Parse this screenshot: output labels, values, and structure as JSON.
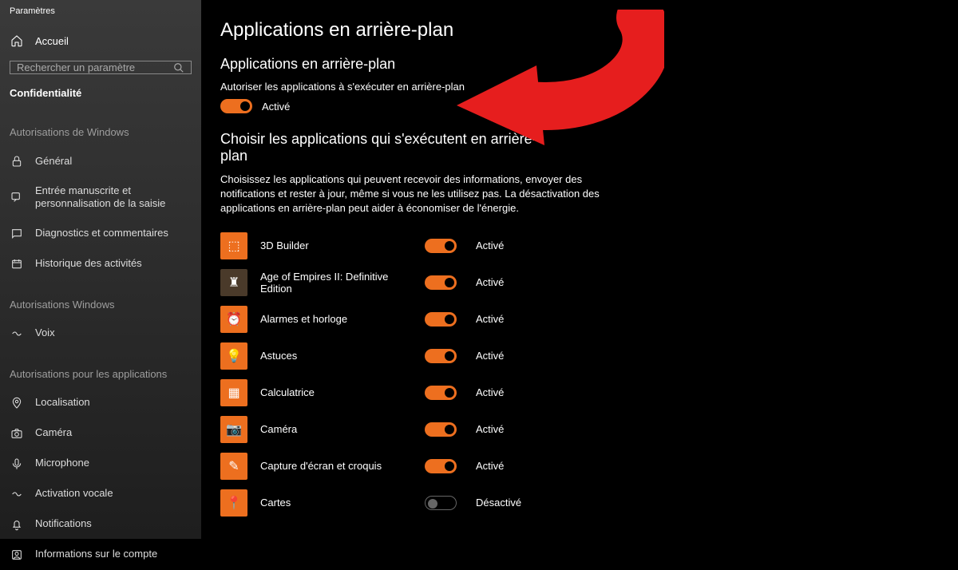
{
  "window_title": "Paramètres",
  "sidebar": {
    "home": "Accueil",
    "search_placeholder": "Rechercher un paramètre",
    "current_section": "Confidentialité",
    "group1_label": "Autorisations de Windows",
    "group1_items": [
      {
        "icon": "lock",
        "label": "Général"
      },
      {
        "icon": "speech",
        "label": "Entrée manuscrite et personnalisation de la saisie"
      },
      {
        "icon": "feedback",
        "label": "Diagnostics et commentaires"
      },
      {
        "icon": "history",
        "label": "Historique des activités"
      }
    ],
    "group2_label": "Autorisations Windows",
    "group2_items": [
      {
        "icon": "voice",
        "label": "Voix"
      }
    ],
    "group3_label": "Autorisations pour les applications",
    "group3_items": [
      {
        "icon": "location",
        "label": "Localisation"
      },
      {
        "icon": "camera",
        "label": "Caméra"
      },
      {
        "icon": "mic",
        "label": "Microphone"
      },
      {
        "icon": "voice",
        "label": "Activation vocale"
      },
      {
        "icon": "bell",
        "label": "Notifications"
      },
      {
        "icon": "account",
        "label": "Informations sur le compte"
      }
    ]
  },
  "main": {
    "title": "Applications en arrière-plan",
    "section1_title": "Applications en arrière-plan",
    "section1_desc": "Autoriser les applications à s'exécuter en arrière-plan",
    "master_toggle_state": "Activé",
    "section2_title": "Choisir les applications qui s'exécutent en arrière-plan",
    "section2_desc": "Choisissez les applications qui peuvent recevoir des informations, envoyer des notifications et rester à jour, même si vous ne les utilisez pas. La désactivation des applications en arrière-plan peut aider à économiser de l'énergie.",
    "states": {
      "on": "Activé",
      "off": "Désactivé"
    },
    "apps": [
      {
        "name": "3D Builder",
        "state": "on",
        "glyph": "⬚"
      },
      {
        "name": "Age of Empires II: Definitive Edition",
        "state": "on",
        "glyph": "♜"
      },
      {
        "name": "Alarmes et horloge",
        "state": "on",
        "glyph": "⏰"
      },
      {
        "name": "Astuces",
        "state": "on",
        "glyph": "💡"
      },
      {
        "name": "Calculatrice",
        "state": "on",
        "glyph": "▦"
      },
      {
        "name": "Caméra",
        "state": "on",
        "glyph": "📷"
      },
      {
        "name": "Capture d'écran et croquis",
        "state": "on",
        "glyph": "✎"
      },
      {
        "name": "Cartes",
        "state": "off",
        "glyph": "📍"
      }
    ]
  }
}
